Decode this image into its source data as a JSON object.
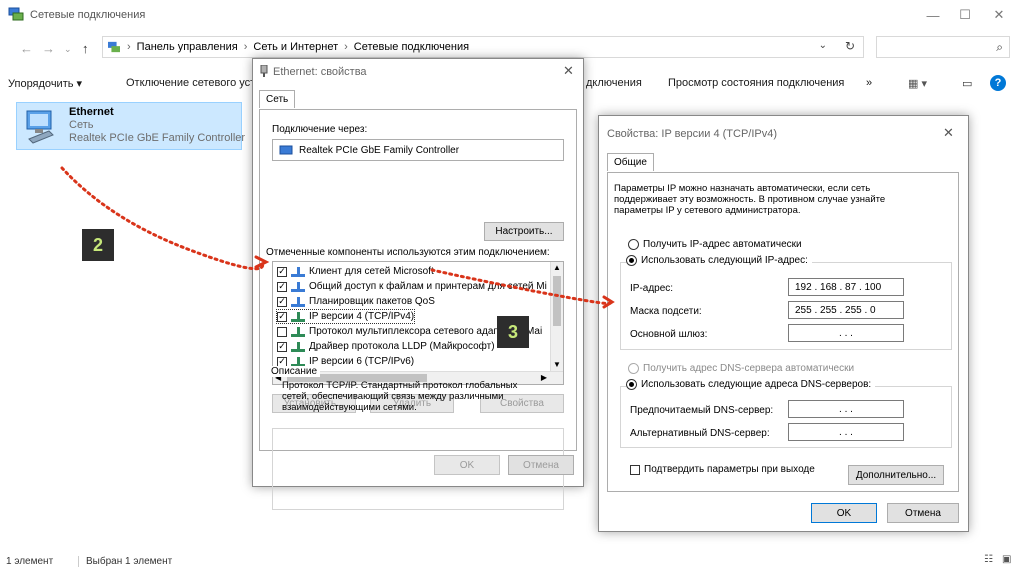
{
  "window": {
    "title": "Сетевые подключения"
  },
  "address": {
    "crumbs": [
      "Панель управления",
      "Сеть и Интернет",
      "Сетевые подключения"
    ],
    "search_placeholder": ""
  },
  "commands": {
    "organize": "Упорядочить ▾",
    "disable": "Отключение сетевого уст",
    "rename": "дключения",
    "status": "Просмотр состояния подключения",
    "more": "»"
  },
  "connection": {
    "name": "Ethernet",
    "type": "Сеть",
    "adapter": "Realtek PCIe GbE Family Controller"
  },
  "status": {
    "count": "1 элемент",
    "selected": "Выбран 1 элемент"
  },
  "props": {
    "title": "Ethernet: свойства",
    "tab": "Сеть",
    "connect_via": "Подключение через:",
    "adapter": "Realtek PCIe GbE Family Controller",
    "configure": "Настроить...",
    "components_label": "Отмеченные компоненты используются этим подключением:",
    "components": [
      {
        "label": "Клиент для сетей Microsoft",
        "checked": true
      },
      {
        "label": "Общий доступ к файлам и принтерам для сетей Mi",
        "checked": true
      },
      {
        "label": "Планировщик пакетов QoS",
        "checked": true
      },
      {
        "label": "IP версии 4 (TCP/IPv4)",
        "checked": true
      },
      {
        "label": "Протокол мультиплексора сетевого адаптера (Mai",
        "checked": false
      },
      {
        "label": "Драйвер протокола LLDP (Майкрософт)",
        "checked": true
      },
      {
        "label": "IP версии 6 (TCP/IPv6)",
        "checked": true
      }
    ],
    "install": "Установить...",
    "remove": "Удалить",
    "properties": "Свойства",
    "description_label": "Описание",
    "description": "Протокол TCP/IP. Стандартный протокол глобальных сетей, обеспечивающий связь между различными взаимодействующими сетями.",
    "ok": "OK",
    "cancel": "Отмена"
  },
  "ipv4": {
    "title": "Свойства: IP версии 4 (TCP/IPv4)",
    "tab": "Общие",
    "intro": "Параметры IP можно назначать автоматически, если сеть поддерживает эту возможность. В противном случае узнайте параметры IP у сетевого администратора.",
    "auto_ip": "Получить IP-адрес автоматически",
    "manual_ip": "Использовать следующий IP-адрес:",
    "ip_label": "IP-адрес:",
    "ip_value": "192 . 168 . 87 . 100",
    "mask_label": "Маска подсети:",
    "mask_value": "255 . 255 . 255 . 0",
    "gateway_label": "Основной шлюз:",
    "gateway_value": ".    .    .",
    "auto_dns": "Получить адрес DNS-сервера автоматически",
    "manual_dns": "Использовать следующие адреса DNS-серверов:",
    "dns1_label": "Предпочитаемый DNS-сервер:",
    "dns1_value": ".    .    .",
    "dns2_label": "Альтернативный DNS-сервер:",
    "dns2_value": ".    .    .",
    "validate": "Подтвердить параметры при выходе",
    "advanced": "Дополнительно...",
    "ok": "OK",
    "cancel": "Отмена"
  },
  "markers": {
    "step2": "2",
    "step3": "3"
  },
  "colors": {
    "accent": "#0078d7",
    "marker_bg": "#2d2d2d",
    "marker_fg": "#c7e87a",
    "dots": "#d9341a"
  }
}
